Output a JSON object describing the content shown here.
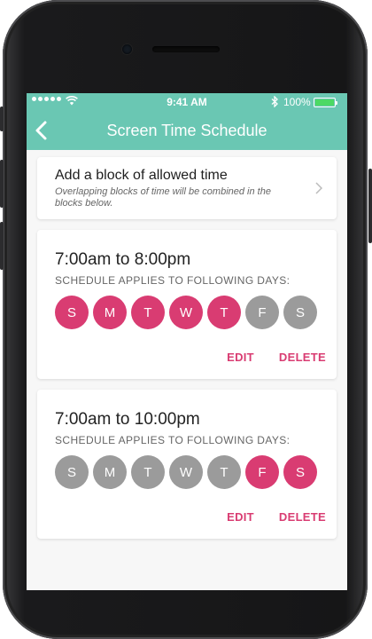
{
  "statusbar": {
    "time": "9:41 AM",
    "battery_pct": "100%"
  },
  "navbar": {
    "title": "Screen Time Schedule"
  },
  "add_block": {
    "title": "Add a block of allowed time",
    "subtitle": "Overlapping blocks of time will be combined in the blocks below."
  },
  "colors": {
    "accent": "#6ac7b3",
    "active_day": "#d93c72",
    "inactive_day": "#9b9b9b"
  },
  "schedules": [
    {
      "time_range": "7:00am to 8:00pm",
      "applies_label": "SCHEDULE APPLIES TO FOLLOWING DAYS:",
      "days": [
        {
          "letter": "S",
          "active": true
        },
        {
          "letter": "M",
          "active": true
        },
        {
          "letter": "T",
          "active": true
        },
        {
          "letter": "W",
          "active": true
        },
        {
          "letter": "T",
          "active": true
        },
        {
          "letter": "F",
          "active": false
        },
        {
          "letter": "S",
          "active": false
        }
      ],
      "edit_label": "EDIT",
      "delete_label": "DELETE"
    },
    {
      "time_range": "7:00am to 10:00pm",
      "applies_label": "SCHEDULE APPLIES TO FOLLOWING DAYS:",
      "days": [
        {
          "letter": "S",
          "active": false
        },
        {
          "letter": "M",
          "active": false
        },
        {
          "letter": "T",
          "active": false
        },
        {
          "letter": "W",
          "active": false
        },
        {
          "letter": "T",
          "active": false
        },
        {
          "letter": "F",
          "active": true
        },
        {
          "letter": "S",
          "active": true
        }
      ],
      "edit_label": "EDIT",
      "delete_label": "DELETE"
    }
  ]
}
